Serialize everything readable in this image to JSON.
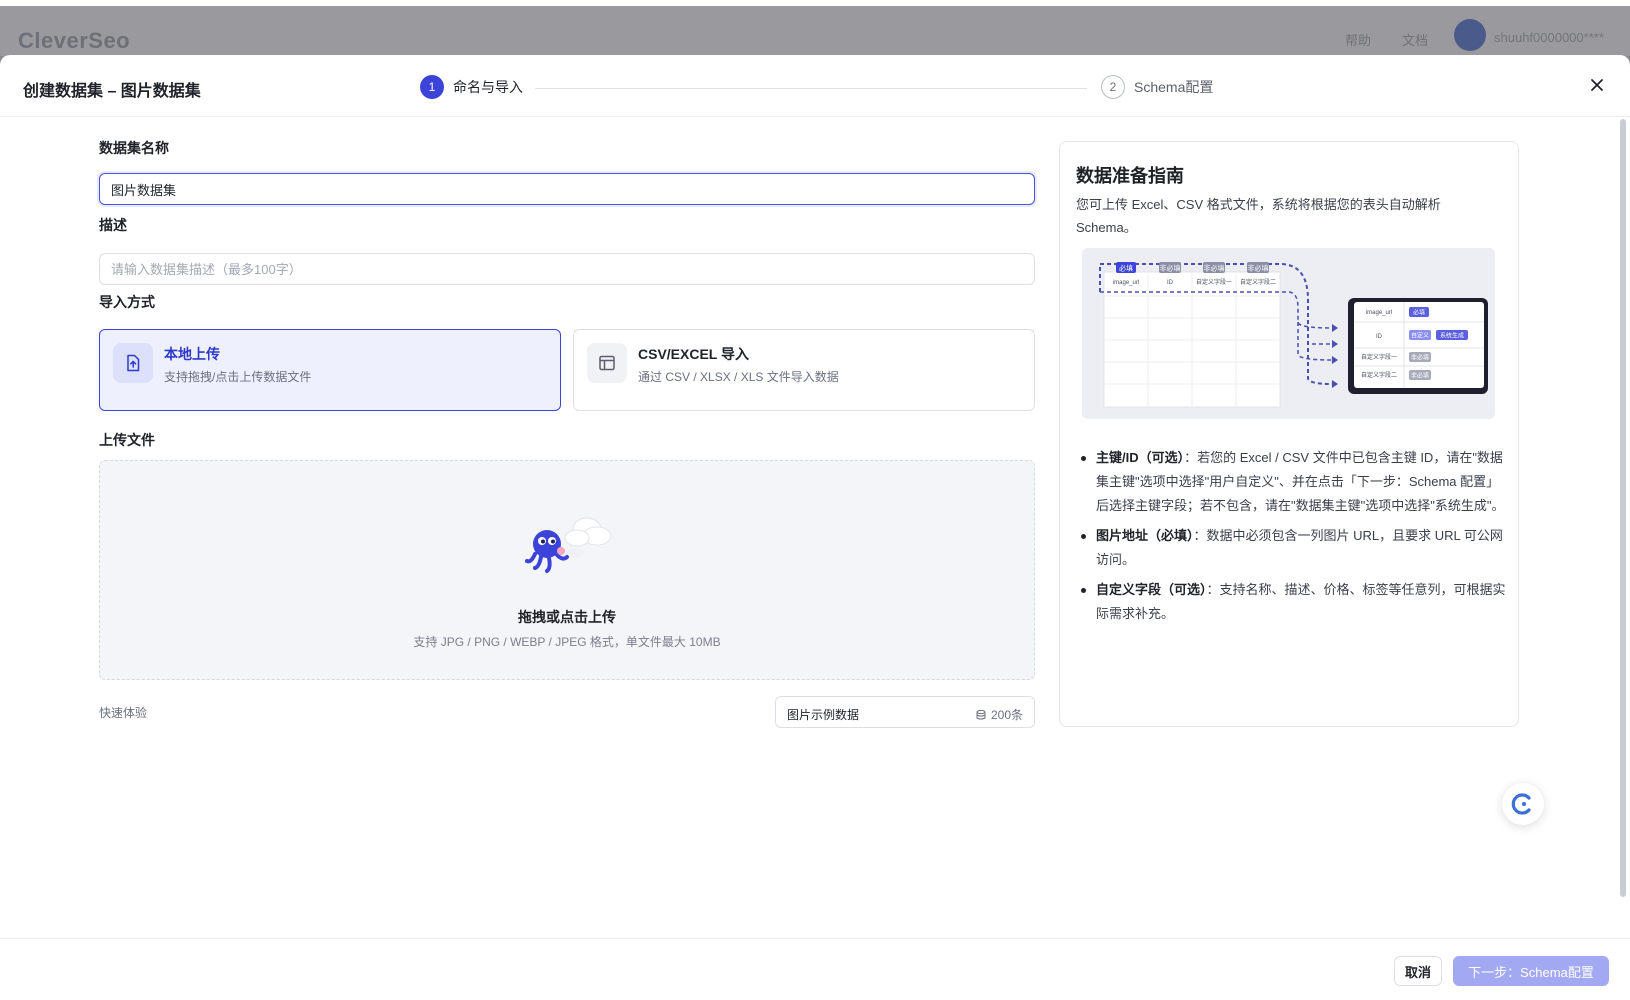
{
  "background": {
    "logo": "CleverSeo",
    "nav": [
      "帮助",
      "文档"
    ],
    "user": "shuuhf0000000****"
  },
  "modal": {
    "title": "创建数据集 – 图片数据集",
    "steps": [
      {
        "number": "1",
        "label": "命名与导入",
        "active": true
      },
      {
        "number": "2",
        "label": "Schema配置",
        "active": false
      }
    ]
  },
  "form": {
    "name_label": "数据集名称",
    "name_value": "图片数据集",
    "desc_label": "描述",
    "desc_placeholder": "请输入数据集描述（最多100字）",
    "method_label": "导入方式",
    "methods": [
      {
        "title": "本地上传",
        "desc": "支持拖拽/点击上传数据文件",
        "selected": true,
        "icon": "file-upload-icon"
      },
      {
        "title": "CSV/EXCEL 导入",
        "desc": "通过 CSV / XLSX / XLS 文件导入数据",
        "selected": false,
        "icon": "table-icon"
      }
    ],
    "upload_label": "上传文件",
    "upload_title": "拖拽或点击上传",
    "upload_desc": "支持 JPG / PNG / WEBP / JPEG 格式，单文件最大 10MB",
    "quick_label": "快速体验",
    "sample_name": "图片示例数据",
    "sample_count": "200条"
  },
  "guide": {
    "title": "数据准备指南",
    "intro": "您可上传 Excel、CSV 格式文件，系统将根据您的表头自动解析 Schema。",
    "diagram": {
      "tags": [
        "必填",
        "非必填",
        "非必填",
        "非必填"
      ],
      "columns": [
        "image_url",
        "ID",
        "自定义字段一",
        "自定义字段二"
      ],
      "rows": [
        "image_url",
        "ID",
        "自定义字段一",
        "自定义字段二"
      ],
      "row_tags": [
        "必填",
        "自定义",
        "系统生成",
        "非必填",
        "非必填"
      ]
    },
    "items": [
      {
        "head": "主键/ID（可选）",
        "text": "：若您的 Excel / CSV 文件中已包含主键 ID，请在\"数据集主键\"选项中选择\"用户自定义\"、并在点击「下一步：Schema 配置」后选择主键字段；若不包含，请在\"数据集主键\"选项中选择\"系统生成\"。"
      },
      {
        "head": "图片地址（必填）",
        "text": "：数据中必须包含一列图片 URL，且要求 URL 可公网访问。"
      },
      {
        "head": "自定义字段（可选）",
        "text": "：支持名称、描述、价格、标签等任意列，可根据实际需求补充。"
      }
    ]
  },
  "footer": {
    "cancel": "取消",
    "next": "下一步：Schema配置"
  },
  "colors": {
    "primary": "#3b43d9",
    "primary_disabled": "#a3a8f2",
    "selected_bg": "#eef0fd"
  }
}
